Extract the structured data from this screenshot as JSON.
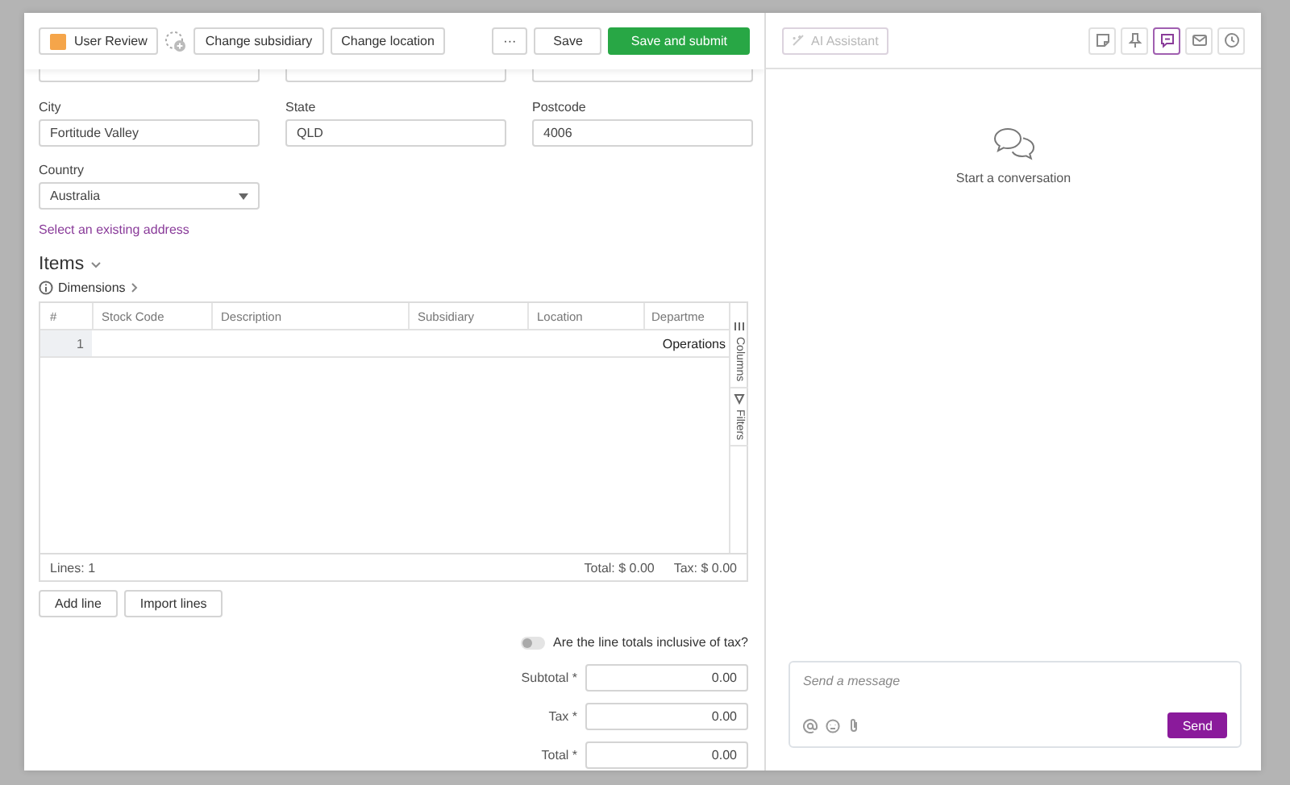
{
  "header": {
    "status": "User Review",
    "actions": [
      "Change subsidiary",
      "Change location"
    ],
    "more": "···",
    "save": "Save",
    "submit": "Save and submit"
  },
  "address": {
    "fields": [
      {
        "label": "City",
        "value": "Fortitude Valley"
      },
      {
        "label": "State",
        "value": "QLD"
      },
      {
        "label": "Postcode",
        "value": "4006"
      }
    ],
    "country": {
      "label": "Country",
      "value": "Australia"
    },
    "link": "Select an existing address"
  },
  "items": {
    "title": "Items",
    "dimensions": "Dimensions",
    "columns": [
      "#",
      "Stock Code",
      "Description",
      "Subsidiary",
      "Location",
      "Departme"
    ],
    "rows": [
      {
        "cells": [
          "1",
          "",
          "",
          "",
          "",
          "Operations"
        ]
      }
    ],
    "side_tabs": [
      {
        "kind": "columns",
        "label": "Columns"
      },
      {
        "kind": "filters",
        "label": "Filters"
      }
    ],
    "footer": {
      "lines": "Lines: 1",
      "total": "Total: $ 0.00",
      "tax": "Tax: $ 0.00"
    }
  },
  "line_buttons": [
    "Add line",
    "Import lines"
  ],
  "tax_inclusive": {
    "label": "Are the line totals inclusive of tax?",
    "on": false
  },
  "totals": [
    {
      "label": "Subtotal *",
      "value": "0.00"
    },
    {
      "label": "Tax *",
      "value": "0.00"
    },
    {
      "label": "Total *",
      "value": "0.00"
    }
  ],
  "assistant": {
    "ai_button": "AI Assistant",
    "tools": [
      {
        "kind": "note",
        "selected": false
      },
      {
        "kind": "pin",
        "selected": false
      },
      {
        "kind": "chat",
        "selected": true
      },
      {
        "kind": "mail",
        "selected": false
      },
      {
        "kind": "history",
        "selected": false
      }
    ],
    "empty_text": "Start a conversation",
    "message": {
      "placeholder": "Send a message",
      "send": "Send"
    }
  }
}
